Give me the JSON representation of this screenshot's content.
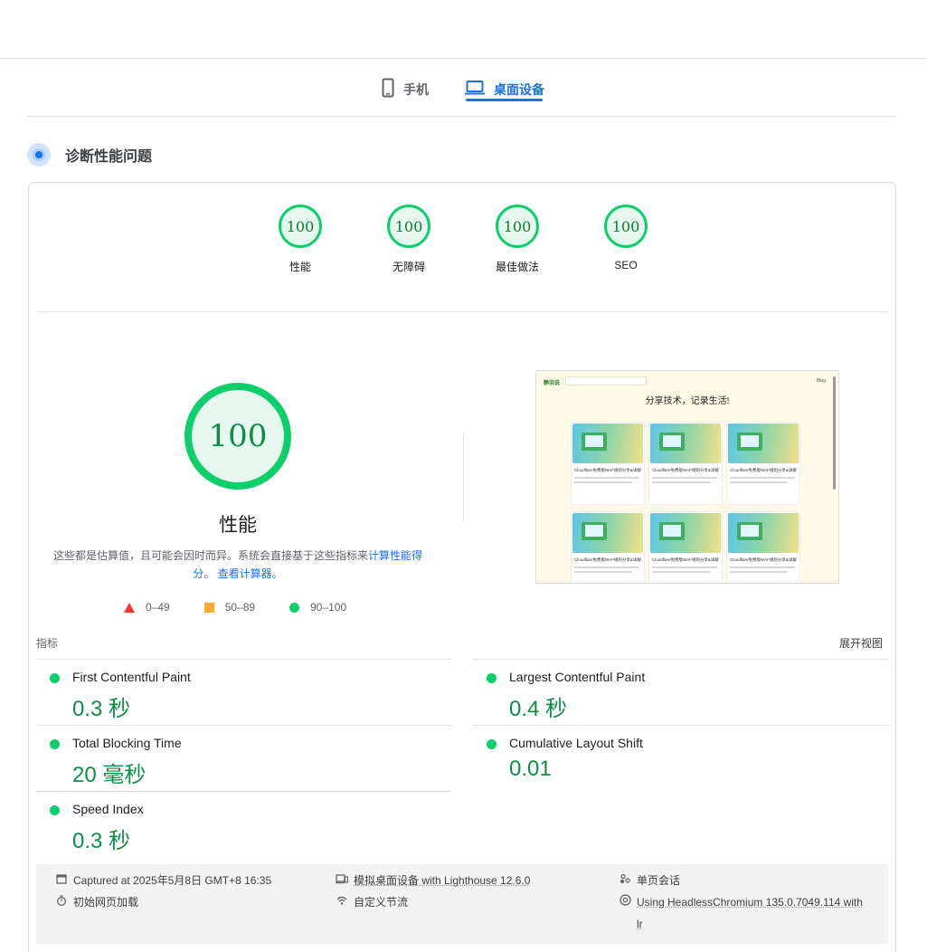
{
  "tabs": {
    "mobile": {
      "label": "手机",
      "icon": "phone-icon"
    },
    "desktop": {
      "label": "桌面设备",
      "icon": "laptop-icon"
    }
  },
  "section": {
    "title": "诊断性能问题",
    "icon": "diagnose-icon"
  },
  "categories": [
    {
      "score": "100",
      "label": "性能"
    },
    {
      "score": "100",
      "label": "无障碍"
    },
    {
      "score": "100",
      "label": "最佳做法"
    },
    {
      "score": "100",
      "label": "SEO"
    }
  ],
  "performance": {
    "score": "100",
    "title": "性能",
    "desc_prefix": "这些都是估算值，且可能会因时而异。系统会直接基于这些指标来",
    "desc_link1": "计算性能得分",
    "desc_mid": "。",
    "desc_link2": "查看计算器。"
  },
  "legend": [
    {
      "range": "0–49",
      "color": "#ff3333",
      "shape": "triangle"
    },
    {
      "range": "50–89",
      "color": "#ffaa33",
      "shape": "square"
    },
    {
      "range": "90–100",
      "color": "#0cce6b",
      "shape": "circle"
    }
  ],
  "thumbnail": {
    "logo": "静羽说",
    "search": "Search",
    "right": "Blog",
    "heading": "分享技术，记录生活!",
    "card_text": "Cloudflare 免费版WAF 规则 分享&详解",
    "card_title": "Cloudflare免费版WAF规则分享&详解"
  },
  "metrics": {
    "label": "指标",
    "expand_label": "展开视图",
    "items": [
      {
        "name": "First Contentful Paint",
        "value": "0.3 秒"
      },
      {
        "name": "Largest Contentful Paint",
        "value": "0.4 秒"
      },
      {
        "name": "Total Blocking Time",
        "value": "20 毫秒"
      },
      {
        "name": "Cumulative Layout Shift",
        "value": "0.01"
      },
      {
        "name": "Speed Index",
        "value": "0.3 秒"
      }
    ]
  },
  "footer": {
    "captured": "Captured at 2025年5月8日 GMT+8 16:35",
    "initial_load": "初始网页加载",
    "emulated": "模拟桌面设备 with Lighthouse 12.6.0",
    "throttling": "自定义节流",
    "single_session": "单页会话",
    "browser_line1": "Using HeadlessChromium 135.0.7049.114 with",
    "browser_line2": "lr"
  },
  "colors": {
    "pass": "#0cce6b",
    "average": "#ffaa33",
    "fail": "#ff3333",
    "accent": "#1a73e8"
  }
}
